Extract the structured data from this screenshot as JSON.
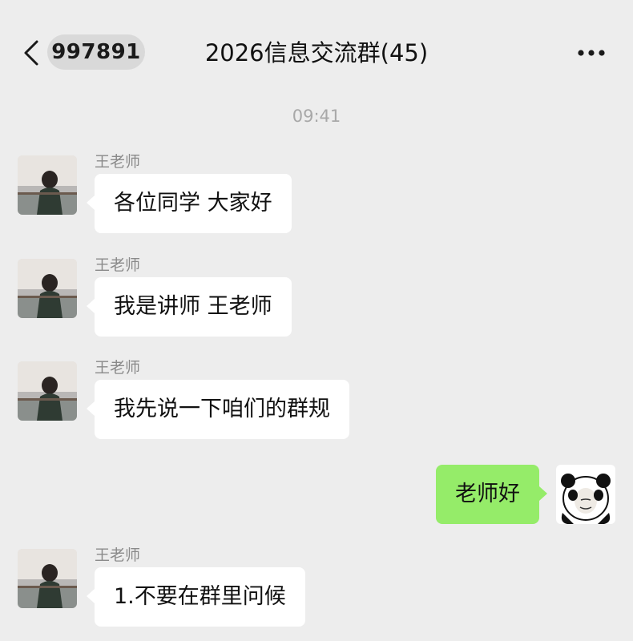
{
  "header": {
    "back_icon": "chevron-left-icon",
    "unread_count": "997891",
    "title": "2026信息交流群(45)",
    "more_icon": "ellipsis-icon"
  },
  "timestamp": "09:41",
  "messages": [
    {
      "sender": "王老师",
      "text": "各位同学 大家好",
      "direction": "incoming"
    },
    {
      "sender": "王老师",
      "text": "我是讲师 王老师",
      "direction": "incoming"
    },
    {
      "sender": "王老师",
      "text": "我先说一下咱们的群规",
      "direction": "incoming"
    },
    {
      "sender": "",
      "text": "老师好",
      "direction": "outgoing"
    },
    {
      "sender": "王老师",
      "text": "1.不要在群里问候",
      "direction": "incoming"
    }
  ],
  "colors": {
    "background": "#ededed",
    "incoming_bubble": "#ffffff",
    "outgoing_bubble": "#95ec69",
    "badge": "#d9d9d9",
    "timestamp": "#a8a8a8"
  }
}
